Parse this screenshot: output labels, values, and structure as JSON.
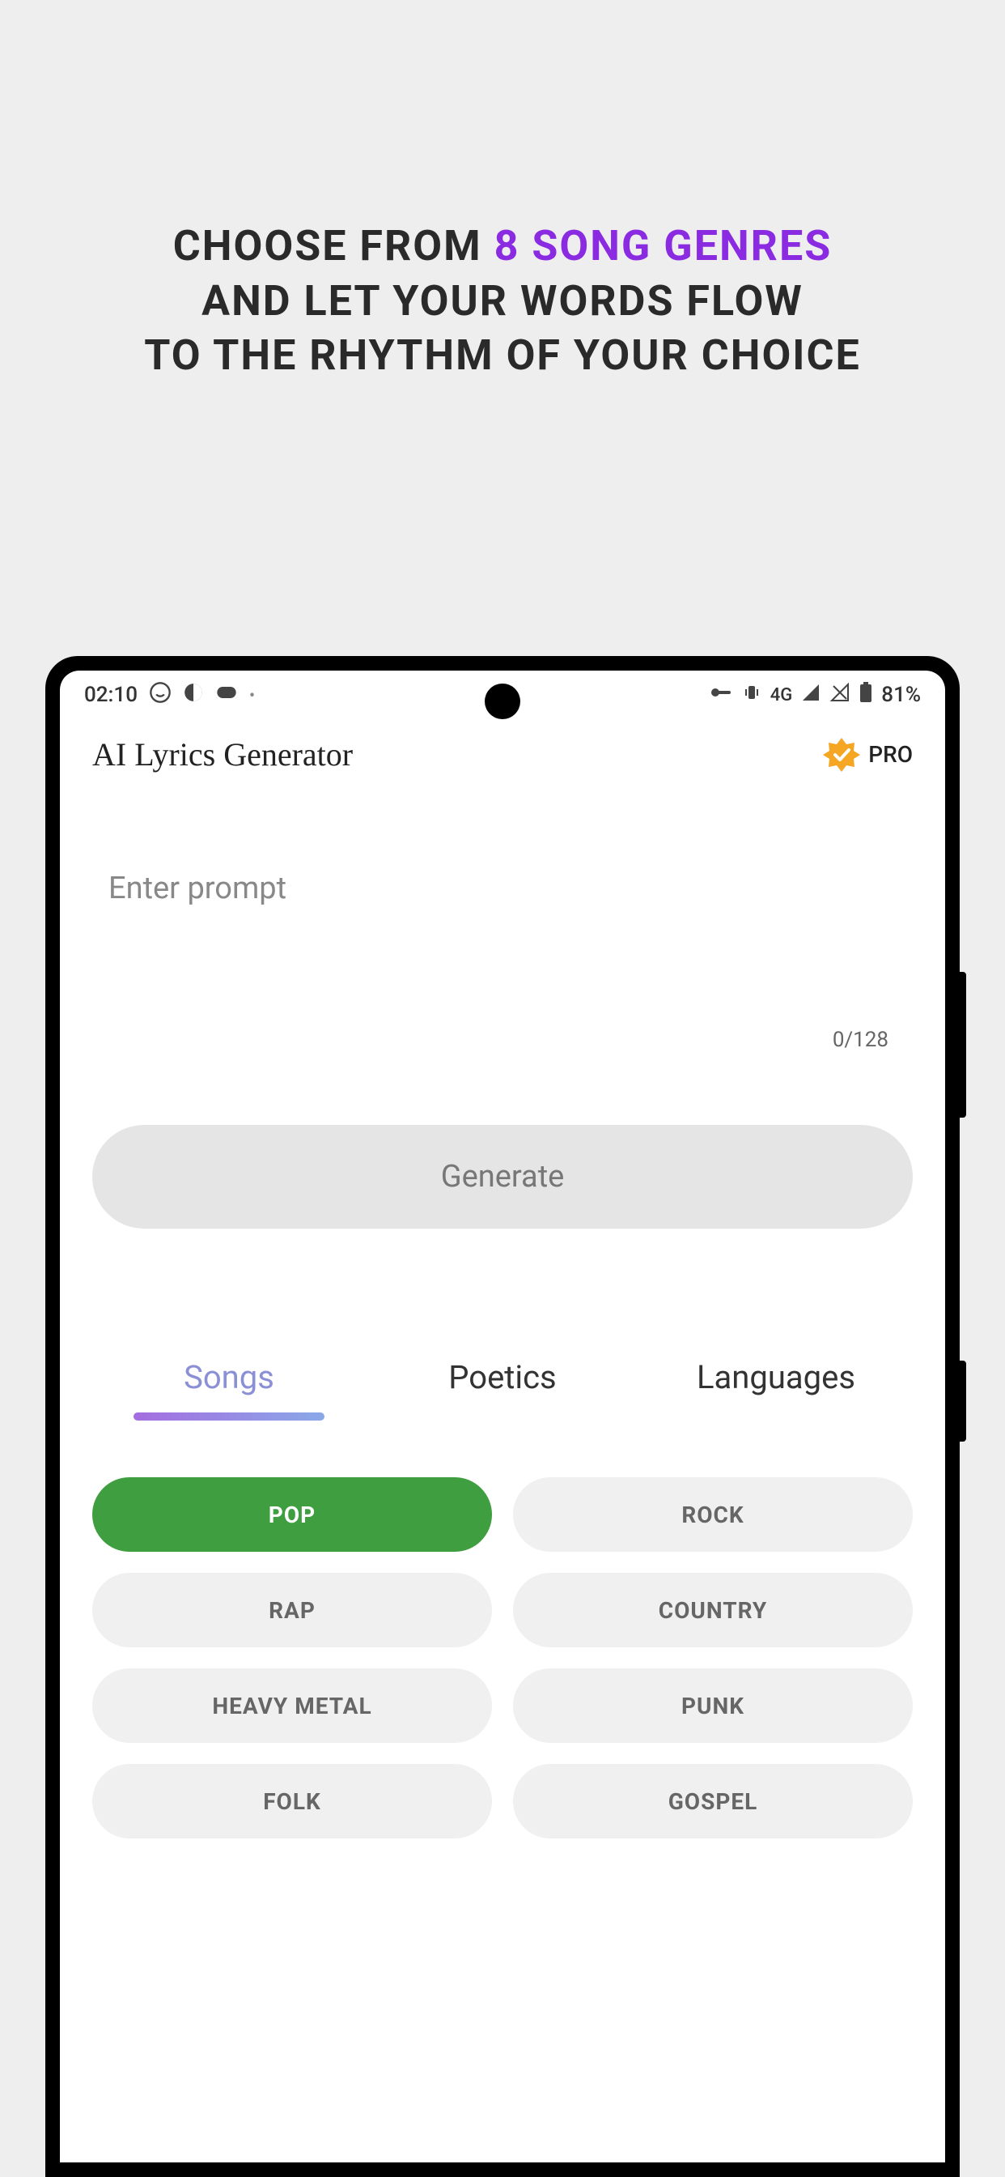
{
  "marketing": {
    "line1_a": "CHOOSE FROM ",
    "line1_b": "8 SONG GENRES",
    "line2": "AND LET YOUR WORDS FLOW",
    "line3": "TO THE RHYTHM OF YOUR CHOICE"
  },
  "status_bar": {
    "time": "02:10",
    "network": "4G",
    "battery": "81%"
  },
  "header": {
    "title": "AI Lyrics Generator",
    "pro_label": "PRO"
  },
  "prompt": {
    "placeholder": "Enter prompt",
    "value": "",
    "char_count": "0/128"
  },
  "generate_label": "Generate",
  "tabs": [
    {
      "label": "Songs",
      "active": true
    },
    {
      "label": "Poetics",
      "active": false
    },
    {
      "label": "Languages",
      "active": false
    }
  ],
  "genres": [
    {
      "label": "POP",
      "selected": true
    },
    {
      "label": "ROCK",
      "selected": false
    },
    {
      "label": "RAP",
      "selected": false
    },
    {
      "label": "COUNTRY",
      "selected": false
    },
    {
      "label": "HEAVY METAL",
      "selected": false
    },
    {
      "label": "PUNK",
      "selected": false
    },
    {
      "label": "FOLK",
      "selected": false
    },
    {
      "label": "GOSPEL",
      "selected": false
    }
  ]
}
